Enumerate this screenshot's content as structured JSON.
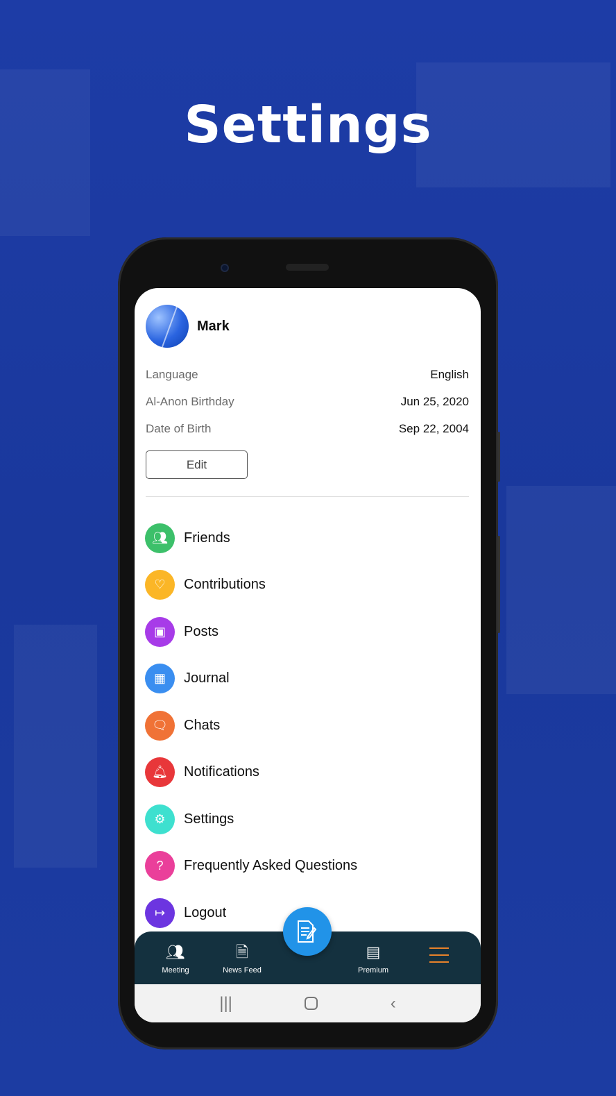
{
  "page_title": "Settings",
  "profile": {
    "name": "Mark",
    "fields": [
      {
        "label": "Language",
        "value": "English"
      },
      {
        "label": "Al-Anon Birthday",
        "value": "Jun 25, 2020"
      },
      {
        "label": "Date of Birth",
        "value": "Sep 22, 2004"
      }
    ],
    "edit_label": "Edit"
  },
  "menu": [
    {
      "label": "Friends",
      "icon": "friends-icon",
      "color": "#3cc06a"
    },
    {
      "label": "Contributions",
      "icon": "heart-hand-icon",
      "color": "#fbb627"
    },
    {
      "label": "Posts",
      "icon": "posts-icon",
      "color": "#a73be8"
    },
    {
      "label": "Journal",
      "icon": "journal-icon",
      "color": "#3a8ef0"
    },
    {
      "label": "Chats",
      "icon": "chat-icon",
      "color": "#f07236"
    },
    {
      "label": "Notifications",
      "icon": "bell-icon",
      "color": "#e8373a"
    },
    {
      "label": "Settings",
      "icon": "gear-icon",
      "color": "#3ee0cf"
    },
    {
      "label": "Frequently Asked Questions",
      "icon": "faq-icon",
      "color": "#ea3f9a"
    },
    {
      "label": "Logout",
      "icon": "logout-icon",
      "color": "#6c35e0"
    }
  ],
  "bottom_nav": {
    "items": [
      {
        "label": "Meeting",
        "icon": "people-icon"
      },
      {
        "label": "News Feed",
        "icon": "document-icon"
      },
      {
        "label": "Premium",
        "icon": "checklist-icon"
      }
    ],
    "fab_icon": "edit-document-icon",
    "menu_icon": "hamburger-icon",
    "accent": "#e8822a"
  }
}
